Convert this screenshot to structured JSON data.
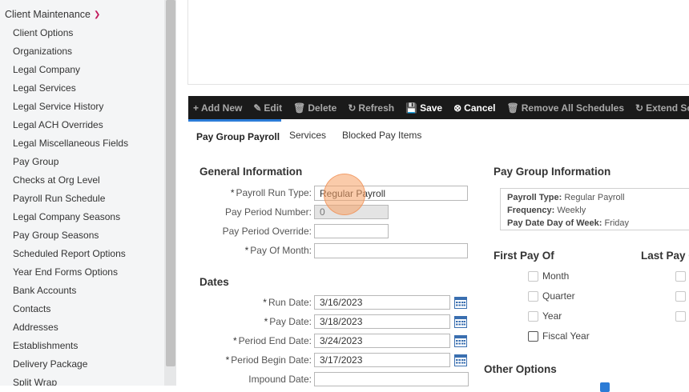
{
  "sidebar": {
    "header": "Client Maintenance",
    "items": [
      "Client Options",
      "Organizations",
      "Legal Company",
      "Legal Services",
      "Legal Service History",
      "Legal ACH Overrides",
      "Legal Miscellaneous Fields",
      "Pay Group",
      "Checks at Org Level",
      "Payroll Run Schedule",
      "Legal Company Seasons",
      "Pay Group Seasons",
      "Scheduled Report Options",
      "Year End Forms Options",
      "Bank Accounts",
      "Contacts",
      "Addresses",
      "Establishments",
      "Delivery Package",
      "Split Wrap"
    ]
  },
  "toolbar": {
    "add": "Add New",
    "edit": "Edit",
    "delete": "Delete",
    "refresh": "Refresh",
    "save": "Save",
    "cancel": "Cancel",
    "remove_all": "Remove All Schedules",
    "extend": "Extend Sched"
  },
  "tabs": {
    "t1": "Pay Group Payroll",
    "t2": "Services",
    "t3": "Blocked Pay Items"
  },
  "general": {
    "title": "General Information",
    "run_type_label": "Payroll Run Type:",
    "run_type_value": "Regular Payroll",
    "period_number_label": "Pay Period Number:",
    "period_number_value": "0",
    "period_override_label": "Pay Period Override:",
    "pay_of_month_label": "Pay Of Month:"
  },
  "dates": {
    "title": "Dates",
    "run_label": "Run Date:",
    "run_value": "3/16/2023",
    "pay_label": "Pay Date:",
    "pay_value": "3/18/2023",
    "end_label": "Period End Date:",
    "end_value": "3/24/2023",
    "begin_label": "Period Begin Date:",
    "begin_value": "3/17/2023",
    "impound_label": "Impound Date:"
  },
  "info": {
    "title": "Pay Group Information",
    "type_key": "Payroll Type:",
    "type_val": "Regular Payroll",
    "freq_key": "Frequency:",
    "freq_val": "Weekly",
    "dow_key": "Pay Date Day of Week:",
    "dow_val": "Friday"
  },
  "first_pay": {
    "title": "First Pay Of",
    "month": "Month",
    "quarter": "Quarter",
    "year": "Year",
    "fiscal": "Fiscal Year"
  },
  "last_pay": {
    "title": "Last Pay O"
  },
  "other": {
    "title": "Other Options"
  },
  "colors": {
    "accent": "#2b7bd6",
    "toolbar_bg": "#1a1a1a",
    "chevron": "#c2185b",
    "cursor": "#f5a064"
  }
}
